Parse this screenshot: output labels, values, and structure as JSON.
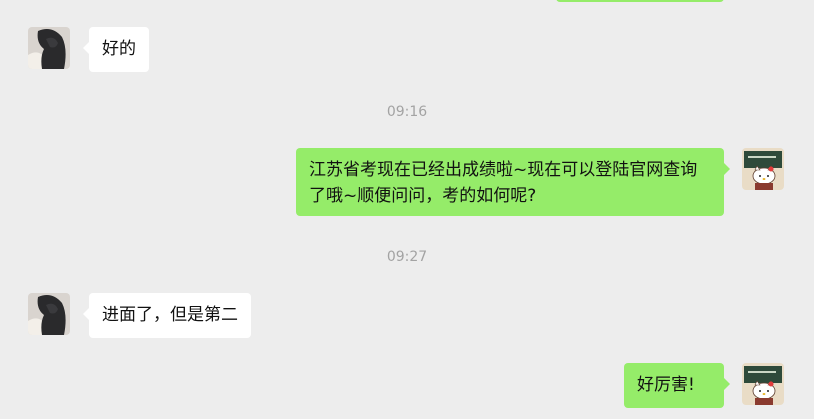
{
  "colors": {
    "background": "#ededed",
    "incoming_bubble": "#ffffff",
    "outgoing_bubble": "#95ec69",
    "timestamp": "#a3a3a3"
  },
  "messages": [
    {
      "sender": "contact",
      "text": "好的"
    },
    {
      "sender": "self",
      "text": "江苏省考现在已经出成绩啦~现在可以登陆官网查询了哦~顺便问问，考的如何呢?"
    },
    {
      "sender": "contact",
      "text": "进面了，但是第二"
    },
    {
      "sender": "self",
      "text": "好厉害!"
    }
  ],
  "timestamps": [
    "09:16",
    "09:27"
  ],
  "icons": {
    "contact_avatar": "dark-hair-person-avatar",
    "self_avatar": "hello-kitty-chalkboard-avatar"
  }
}
